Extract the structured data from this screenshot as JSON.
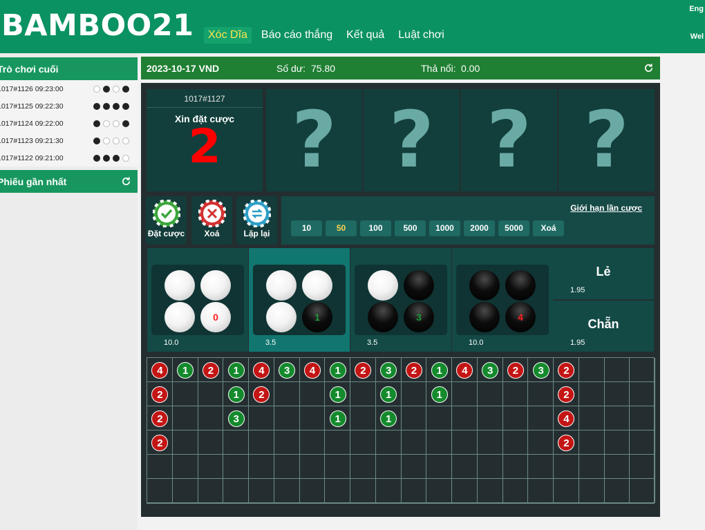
{
  "header": {
    "logo": "BAMBOO21",
    "nav": [
      "Xóc Dĩa",
      "Báo cáo thắng",
      "Kết quả",
      "Luật chơi"
    ],
    "active_nav": 0,
    "lang": "Eng",
    "welcome": "Wel"
  },
  "sidebar": {
    "last_games_title": "Trò chơi cuối",
    "last_games": [
      {
        "label": "1017#1126 09:23:00",
        "dots": [
          "w",
          "b",
          "w",
          "b"
        ]
      },
      {
        "label": "1017#1125 09:22:30",
        "dots": [
          "b",
          "b",
          "b",
          "b"
        ]
      },
      {
        "label": "1017#1124 09:22:00",
        "dots": [
          "b",
          "w",
          "w",
          "b"
        ]
      },
      {
        "label": "1017#1123 09:21:30",
        "dots": [
          "b",
          "w",
          "w",
          "w"
        ]
      },
      {
        "label": "1017#1122 09:21:00",
        "dots": [
          "b",
          "b",
          "b",
          "w"
        ]
      }
    ],
    "recent_tickets_title": "Phiếu gần nhất"
  },
  "topbar": {
    "date": "2023-10-17 VND",
    "balance_label": "Số dư:",
    "balance": "75.80",
    "float_label": "Thả nổi:",
    "float": "0.00"
  },
  "round": {
    "id": "1017#1127",
    "message": "Xin đặt cược",
    "countdown": "2",
    "cards": [
      "?",
      "?",
      "?",
      "?"
    ]
  },
  "actions": {
    "place": "Đặt cược",
    "clear": "Xoá",
    "repeat": "Lặp lại"
  },
  "chips": {
    "limit_label": "Giới hạn lần cược",
    "values": [
      "10",
      "50",
      "100",
      "500",
      "1000",
      "2000",
      "5000",
      "Xoá"
    ],
    "selected": "50"
  },
  "bets": [
    {
      "balls": [
        "w",
        "w",
        "w",
        "w"
      ],
      "count": "0",
      "odds": "10.0"
    },
    {
      "balls": [
        "w",
        "w",
        "w",
        "b"
      ],
      "count": "1",
      "odds": "3.5"
    },
    {
      "balls": [
        "w",
        "b",
        "b",
        "b"
      ],
      "count": "3",
      "odds": "3.5"
    },
    {
      "balls": [
        "b",
        "b",
        "b",
        "b"
      ],
      "count": "4",
      "odds": "10.0"
    }
  ],
  "side_bets": [
    {
      "name": "Lẻ",
      "odds": "1.95"
    },
    {
      "name": "Chẵn",
      "odds": "1.95"
    }
  ],
  "colors": {
    "header": "#0b9262",
    "topbar": "#1f7f33",
    "red": "#c41515",
    "green": "#148a2c",
    "countdown": "#ff0000"
  },
  "road": {
    "columns": 20,
    "rows": 6,
    "cols_data": [
      [
        "4",
        "2",
        "2",
        "2"
      ],
      [
        "1"
      ],
      [
        "2"
      ],
      [
        "1",
        "1",
        "3"
      ],
      [
        "4",
        "2"
      ],
      [
        "3"
      ],
      [
        "4"
      ],
      [
        "1",
        "1",
        "1"
      ],
      [
        "2"
      ],
      [
        "3",
        "1",
        "1"
      ],
      [
        "2"
      ],
      [
        "1",
        "1"
      ],
      [
        "4"
      ],
      [
        "3"
      ],
      [
        "2"
      ],
      [
        "3"
      ],
      [
        "2",
        "2",
        "4",
        "2"
      ]
    ]
  }
}
